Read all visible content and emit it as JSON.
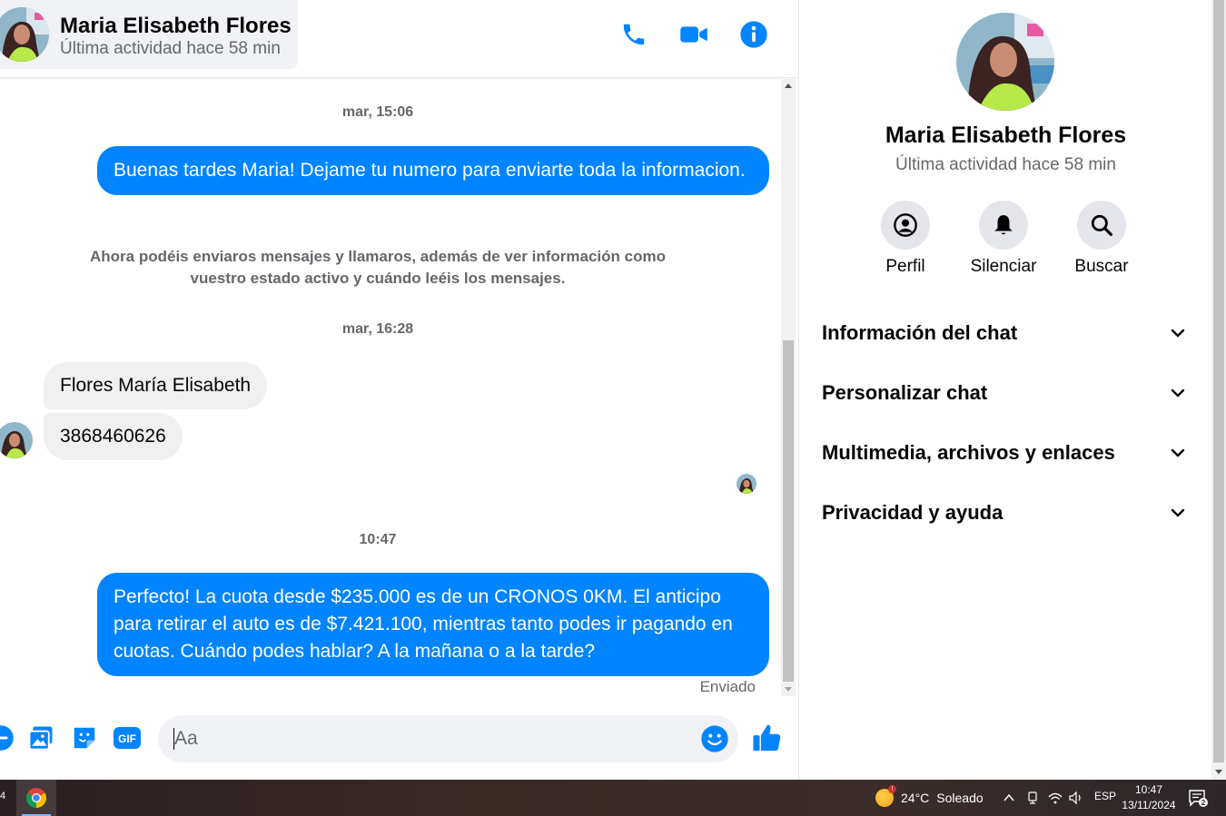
{
  "header": {
    "name": "Maria Elisabeth Flores",
    "status": "Última actividad hace 58 min"
  },
  "messages": {
    "ts1": "mar, 15:06",
    "out1": "Buenas tardes Maria! Dejame tu numero para enviarte toda la informacion.",
    "system": "Ahora podéis enviaros mensajes y llamaros, además de ver información como vuestro estado activo y cuándo leéis los mensajes.",
    "ts2": "mar, 16:28",
    "in1": "Flores María Elisabeth",
    "in2": "3868460626",
    "ts3": "10:47",
    "out2": "Perfecto! La cuota desde $235.000 es de un CRONOS 0KM. El anticipo para retirar el auto es de $7.421.100, mientras tanto podes ir pagando en cuotas. Cuándo podes hablar? A la mañana o a la tarde?",
    "sent": "Enviado"
  },
  "composer": {
    "placeholder": "Aa",
    "gif": "GIF"
  },
  "panel": {
    "name": "Maria Elisabeth Flores",
    "status": "Última actividad hace 58 min",
    "actions": [
      {
        "label": "Perfil",
        "icon": "profile-icon"
      },
      {
        "label": "Silenciar",
        "icon": "bell-icon"
      },
      {
        "label": "Buscar",
        "icon": "search-icon"
      }
    ],
    "sections": [
      {
        "label": "Información del chat"
      },
      {
        "label": "Personalizar chat"
      },
      {
        "label": "Multimedia, archivos y enlaces"
      },
      {
        "label": "Privacidad y ayuda"
      }
    ]
  },
  "taskbar": {
    "badge_left": "4",
    "weather_temp": "24°C",
    "weather_text": "Soleado",
    "weather_badge": "!",
    "lang": "ESP",
    "time": "10:47",
    "date": "13/11/2024",
    "notif_count": "2"
  },
  "colors": {
    "accent": "#0084ff",
    "bubble_in": "#f0f0f0",
    "muted_text": "#65676b"
  }
}
